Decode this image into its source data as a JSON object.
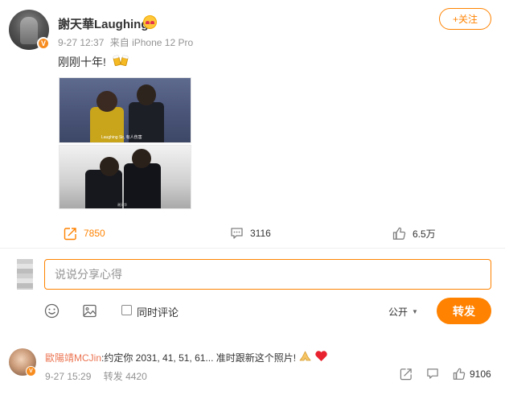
{
  "post": {
    "author": "謝天華Laughing",
    "author_badge_icon": "verified-v-icon",
    "author_emoji": "heart-eyes-emoji-icon",
    "timestamp": "9-27 12:37",
    "source": "来自 iPhone 12 Pro",
    "follow_label": "+关注",
    "text": "刚刚十年!",
    "text_emoji": "beer-cheers-emoji-icon",
    "images": [
      {
        "caption": "Laughing Sir, 有人伤害"
      },
      {
        "caption": "谢天华"
      }
    ],
    "actions": {
      "repost": {
        "icon": "repost-icon",
        "count": "7850"
      },
      "comment": {
        "icon": "comment-icon",
        "count": "3116"
      },
      "like": {
        "icon": "thumbs-up-icon",
        "count": "6.5万"
      }
    }
  },
  "compose": {
    "placeholder": "说说分享心得",
    "emoji_icon": "smiley-icon",
    "image_icon": "image-icon",
    "checkbox_label": "同时评论",
    "privacy_label": "公开",
    "send_label": "转发"
  },
  "comment": {
    "author": "歐陽靖MCJin",
    "text": ":约定你 2031, 41, 51, 61... 准时跟新这个照片!",
    "emojis": [
      "praying-hands-emoji-icon",
      "red-heart-emoji-icon"
    ],
    "timestamp": "9-27 15:29",
    "repost_label": "转发 4420",
    "like_count": "9106"
  },
  "colors": {
    "accent": "#ff8200",
    "name_link": "#eb7350",
    "meta_gray": "#939393",
    "text": "#333333"
  }
}
